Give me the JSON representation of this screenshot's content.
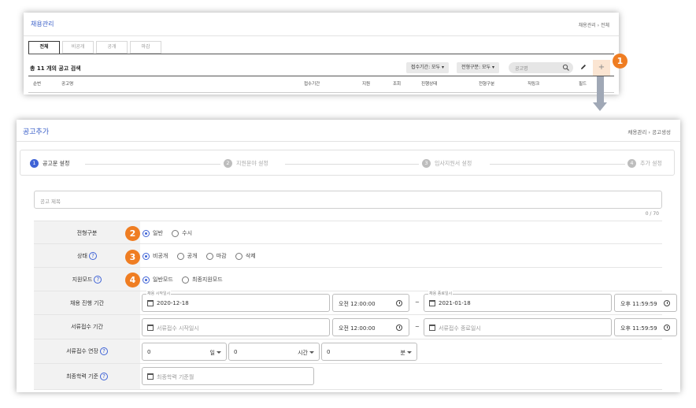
{
  "list_page": {
    "title": "채용관리",
    "breadcrumb": "채용관리  ›  전체",
    "tabs": [
      "전체",
      "비공개",
      "공개",
      "마감"
    ],
    "total_text": "총 11 개의 공고 검색",
    "filter_period": "접수기간: 모두",
    "filter_type": "전형구분: 모두",
    "search_placeholder": "공고명",
    "add_button": "+",
    "columns": [
      "순번",
      "공고명",
      "접수기간",
      "지원",
      "조회",
      "진행상태",
      "전형구분",
      "직링크",
      "필드"
    ]
  },
  "callouts": [
    "1",
    "2",
    "3",
    "4"
  ],
  "add_page": {
    "title": "공고추가",
    "breadcrumb": "채용관리  ›  공고생성",
    "steps": [
      {
        "num": "1",
        "label": "공고문 설정"
      },
      {
        "num": "2",
        "label": "지원문야 설정"
      },
      {
        "num": "3",
        "label": "입사지원서 설정"
      },
      {
        "num": "4",
        "label": "추가 설정"
      }
    ],
    "title_placeholder": "공고 제목",
    "title_count": "0 / 70",
    "rows": {
      "selection_type": {
        "label": "전형구분",
        "options": [
          "일반",
          "수시"
        ],
        "selected": "일반"
      },
      "status": {
        "label": "상태",
        "options": [
          "비공개",
          "공개",
          "마감",
          "삭제"
        ],
        "selected": "비공개"
      },
      "apply_mode": {
        "label": "지원모드",
        "options": [
          "일반모드",
          "최종지원모드"
        ],
        "selected": "일반모드"
      },
      "hiring_period": {
        "label": "채용 진행 기간",
        "start_label": "채용 시작일시",
        "start_date": "2020-12-18",
        "start_time": "오전 12:00:00",
        "end_label": "채용 종료일시",
        "end_date": "2021-01-18",
        "end_time": "오후 11:59:59"
      },
      "document_period": {
        "label": "서류접수 기간",
        "start_placeholder": "서류접수 시작일시",
        "start_time": "오전 12:00:00",
        "end_placeholder": "서류접수 종료일시",
        "end_time": "오후 11:59:59"
      },
      "document_extension": {
        "label": "서류접수 연장",
        "days_value": "0",
        "days_unit": "일",
        "hours_value": "0",
        "hours_unit": "시간",
        "minutes_value": "0",
        "minutes_unit": "분"
      },
      "education_date": {
        "label": "최종학력 기준",
        "placeholder": "최종학력 기준월"
      }
    },
    "help_icon": "?",
    "tilde": "~"
  },
  "colors": {
    "accent_blue": "#3f63d6",
    "callout_orange": "#ef7d22",
    "arrow_gray": "#a0a8b6",
    "plus_bg": "#fbe5d2"
  }
}
